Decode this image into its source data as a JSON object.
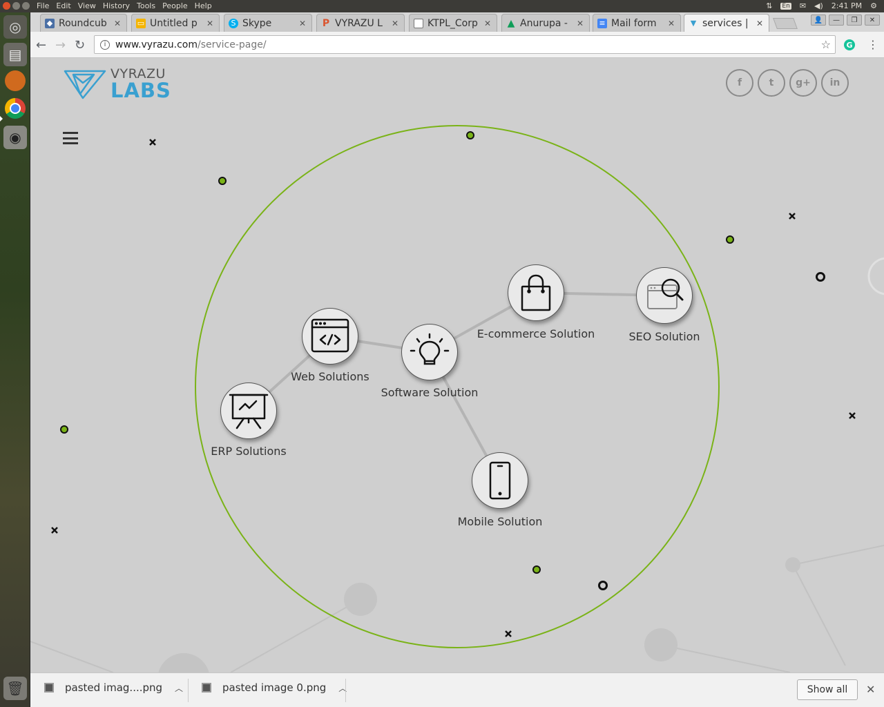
{
  "os": {
    "menu": [
      "File",
      "Edit",
      "View",
      "History",
      "Tools",
      "People",
      "Help"
    ],
    "tray": {
      "lang": "En",
      "time": "2:41 PM"
    }
  },
  "tabs": [
    {
      "title": "Roundcub",
      "favicon": "roundcube-icon",
      "color": "#4a6fa5"
    },
    {
      "title": "Untitled p",
      "favicon": "slides-icon",
      "color": "#f4b400"
    },
    {
      "title": "Skype",
      "favicon": "skype-icon",
      "color": "#00aff0"
    },
    {
      "title": "VYRAZU L",
      "favicon": "producthunt-icon",
      "color": "#da552f"
    },
    {
      "title": "KTPL_Corp",
      "favicon": "document-icon",
      "color": "#777777"
    },
    {
      "title": "Anurupa -",
      "favicon": "drive-icon",
      "color": "#0f9d58"
    },
    {
      "title": "Mail form",
      "favicon": "docs-icon",
      "color": "#4285f4"
    },
    {
      "title": "services |",
      "favicon": "vyrazu-icon",
      "color": "#3aa0d0",
      "active": true
    }
  ],
  "address": {
    "domain": "www.vyrazu.com",
    "path": "/service-page/"
  },
  "page": {
    "logo": {
      "line1": "VYRAZU",
      "line2": "LABS"
    },
    "social": [
      "f",
      "t",
      "g+",
      "in"
    ],
    "nodes": {
      "software": "Software Solution",
      "web": "Web Solutions",
      "erp": "ERP Solutions",
      "ecommerce": "E-commerce Solution",
      "seo": "SEO Solution",
      "mobile": "Mobile Solution"
    }
  },
  "downloads": {
    "items": [
      "pasted imag....png",
      "pasted image 0.png"
    ],
    "show_all": "Show all"
  },
  "colors": {
    "accent_green": "#7ab317",
    "logo_blue": "#3aa0d0"
  }
}
